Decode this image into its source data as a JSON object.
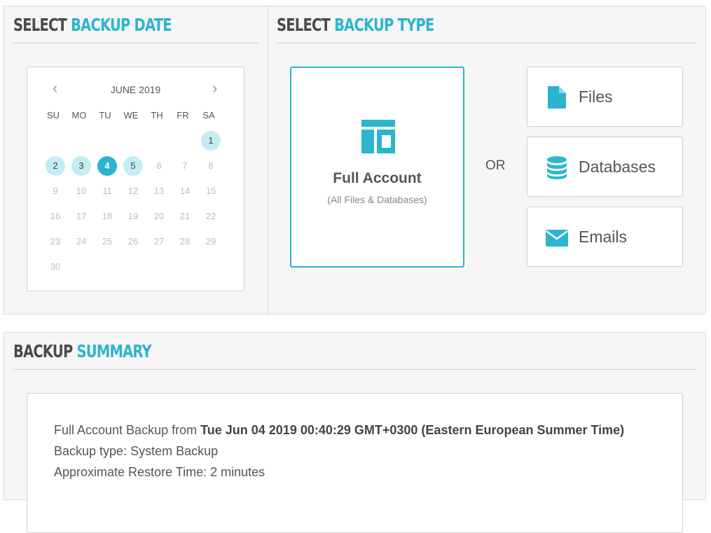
{
  "backup_date": {
    "heading_dark": "SELECT",
    "heading_accent": "BACKUP DATE",
    "calendar": {
      "month_label": "JUNE 2019",
      "prev_icon": "chevron-left-icon",
      "next_icon": "chevron-right-icon",
      "weekdays": [
        "SU",
        "MO",
        "TU",
        "WE",
        "TH",
        "FR",
        "SA"
      ],
      "days": [
        "1",
        "2",
        "3",
        "4",
        "5",
        "6",
        "7",
        "8",
        "9",
        "10",
        "11",
        "12",
        "13",
        "14",
        "15",
        "16",
        "17",
        "18",
        "19",
        "20",
        "21",
        "22",
        "23",
        "24",
        "25",
        "26",
        "27",
        "28",
        "29",
        "30"
      ],
      "available_days": [
        "1",
        "2",
        "3",
        "4",
        "5"
      ],
      "selected_day": "4"
    }
  },
  "backup_type": {
    "heading_dark": "SELECT",
    "heading_accent": "BACKUP TYPE",
    "full_account": {
      "title": "Full Account",
      "subtitle": "(All Files & Databases)",
      "icon": "layout-icon"
    },
    "or_label": "OR",
    "options": [
      {
        "label": "Files",
        "icon": "file-icon"
      },
      {
        "label": "Databases",
        "icon": "database-icon"
      },
      {
        "label": "Emails",
        "icon": "envelope-icon"
      }
    ]
  },
  "summary": {
    "heading_dark": "BACKUP",
    "heading_accent": "SUMMARY",
    "line1_prefix": "Full Account Backup from ",
    "line1_date": "Tue Jun 04 2019 00:40:29 GMT+0300 (Eastern European Summer Time)",
    "line2": "Backup type: System Backup",
    "line3": "Approximate Restore Time: 2 minutes"
  },
  "colors": {
    "accent": "#2cb5cf",
    "available_day": "#c4ecf5",
    "panel_bg": "#f6f6f6"
  }
}
